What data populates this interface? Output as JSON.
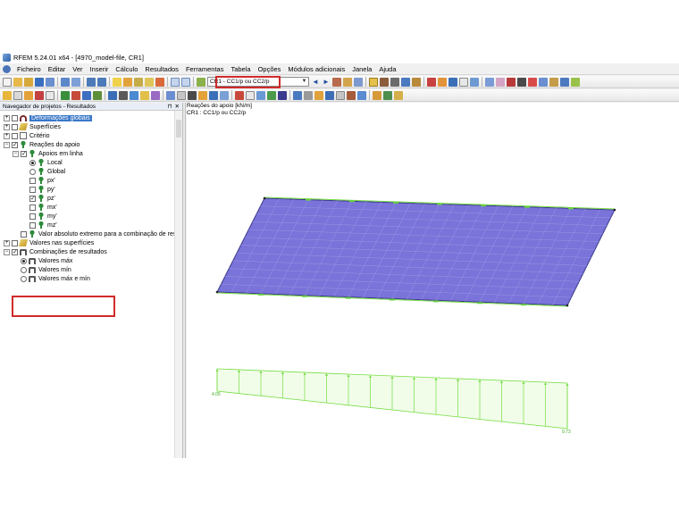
{
  "window": {
    "title": "RFEM 5.24.01 x64 - [4970_model-file, CR1]"
  },
  "menu": [
    "Ficheiro",
    "Editar",
    "Ver",
    "Inserir",
    "Cálculo",
    "Resultados",
    "Ferramentas",
    "Tabela",
    "Opções",
    "Módulos adicionais",
    "Janela",
    "Ajuda"
  ],
  "toolbar": {
    "load_case_combo": "CR1 - CC1/p ou CC2/p"
  },
  "navigator": {
    "title": "Navegador de projetos - Resultados",
    "items": [
      {
        "label": "Deformações globais",
        "selected": true
      },
      {
        "label": "Superfícies"
      },
      {
        "label": "Critério"
      },
      {
        "label": "Reações do apoio"
      },
      {
        "label": "Apoios em linha"
      },
      {
        "label": "Local"
      },
      {
        "label": "Global"
      },
      {
        "label": "px'"
      },
      {
        "label": "py'"
      },
      {
        "label": "pz'"
      },
      {
        "label": "mx'"
      },
      {
        "label": "my'"
      },
      {
        "label": "mz'"
      },
      {
        "label": "Valor absoluto extremo para a combinação de resu"
      },
      {
        "label": "Valores nas superfícies"
      },
      {
        "label": "Combinações de resultados"
      },
      {
        "label": "Valores máx"
      },
      {
        "label": "Valores mín"
      },
      {
        "label": "Valores máx e mín"
      }
    ]
  },
  "view": {
    "title": "Reações do apoio [kN/m]",
    "subtitle": "CR1 : CC1/p ou CC2/p",
    "diagram": {
      "left_value": "4.05",
      "right_value": "9.73"
    }
  },
  "colors": {
    "surface_fill": "#7a73d9",
    "surface_grid": "#9a95e6",
    "diagram_line": "#77dd44",
    "highlight": "#d12a2a"
  }
}
